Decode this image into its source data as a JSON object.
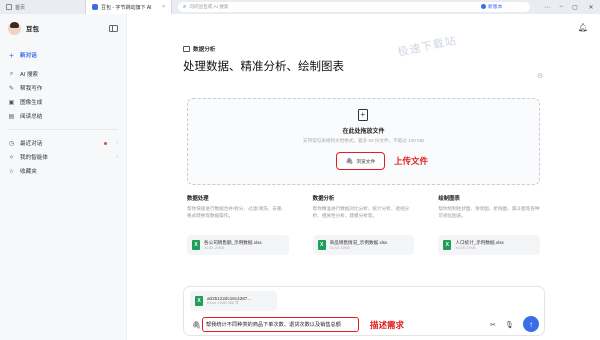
{
  "browser": {
    "tabs": [
      {
        "label": "首页"
      },
      {
        "label": "豆包 - 字节跳动旗下 AI"
      }
    ],
    "address_placeholder": "问问豆包或 AI 搜索",
    "new_version_label": "新版本",
    "close_glyph": "×"
  },
  "sidebar": {
    "app_name": "豆包",
    "new_chat": "新对话",
    "items": [
      {
        "label": "AI 搜索",
        "icon": "search-icon"
      },
      {
        "label": "帮我写作",
        "icon": "pen-icon"
      },
      {
        "label": "图像生成",
        "icon": "image-icon"
      },
      {
        "label": "阅读总结",
        "icon": "book-icon"
      }
    ],
    "recent": {
      "label": "最近对话"
    },
    "agents": {
      "label": "我的智能体"
    },
    "favorites": {
      "label": "收藏夹"
    }
  },
  "main": {
    "badge": "数据分析",
    "title": "处理数据、精准分析、绘制图表",
    "watermark": "极速下载站",
    "dropzone": {
      "title": "在此处拖放文件",
      "subtitle": "支持常见表格和文档格式，最多 50 份文件，不超过 100 MB",
      "browse_label": "浏览文件"
    },
    "upload_annotation": "上传文件",
    "columns": [
      {
        "title": "数据处理",
        "desc": "帮你快速进行数据合并/拆分、过滤/清洗、去重、格式转换等数据操作。"
      },
      {
        "title": "数据分析",
        "desc": "帮你精准进行数据对比分析、统计分析、透视分析、相关性分析、建模分析等。"
      },
      {
        "title": "绘制图表",
        "desc": "帮你绘制柱状图、饼状图、折线图、漏斗图等各种可视化图表。"
      }
    ],
    "sample_files": [
      {
        "name": "各公司销售额_示例数据.xlsx",
        "size": "XLSX 21KB"
      },
      {
        "name": "商品销售情况_示例数据.xlsx",
        "size": "XLSX 19KB"
      },
      {
        "name": "人口统计_示例数据.xlsx",
        "size": "XLSX 17KB"
      }
    ],
    "composer": {
      "attachment": {
        "name": "a025122dc18c4287...",
        "size": "Excel 19KB 366 字"
      },
      "prompt": "帮我统计不同种类的商品下单次数、退货次数以及销售总额",
      "annotation": "描述需求"
    }
  },
  "colors": {
    "accent": "#3a6ee8",
    "annotation": "#e02020",
    "excel": "#1f9f5a"
  }
}
